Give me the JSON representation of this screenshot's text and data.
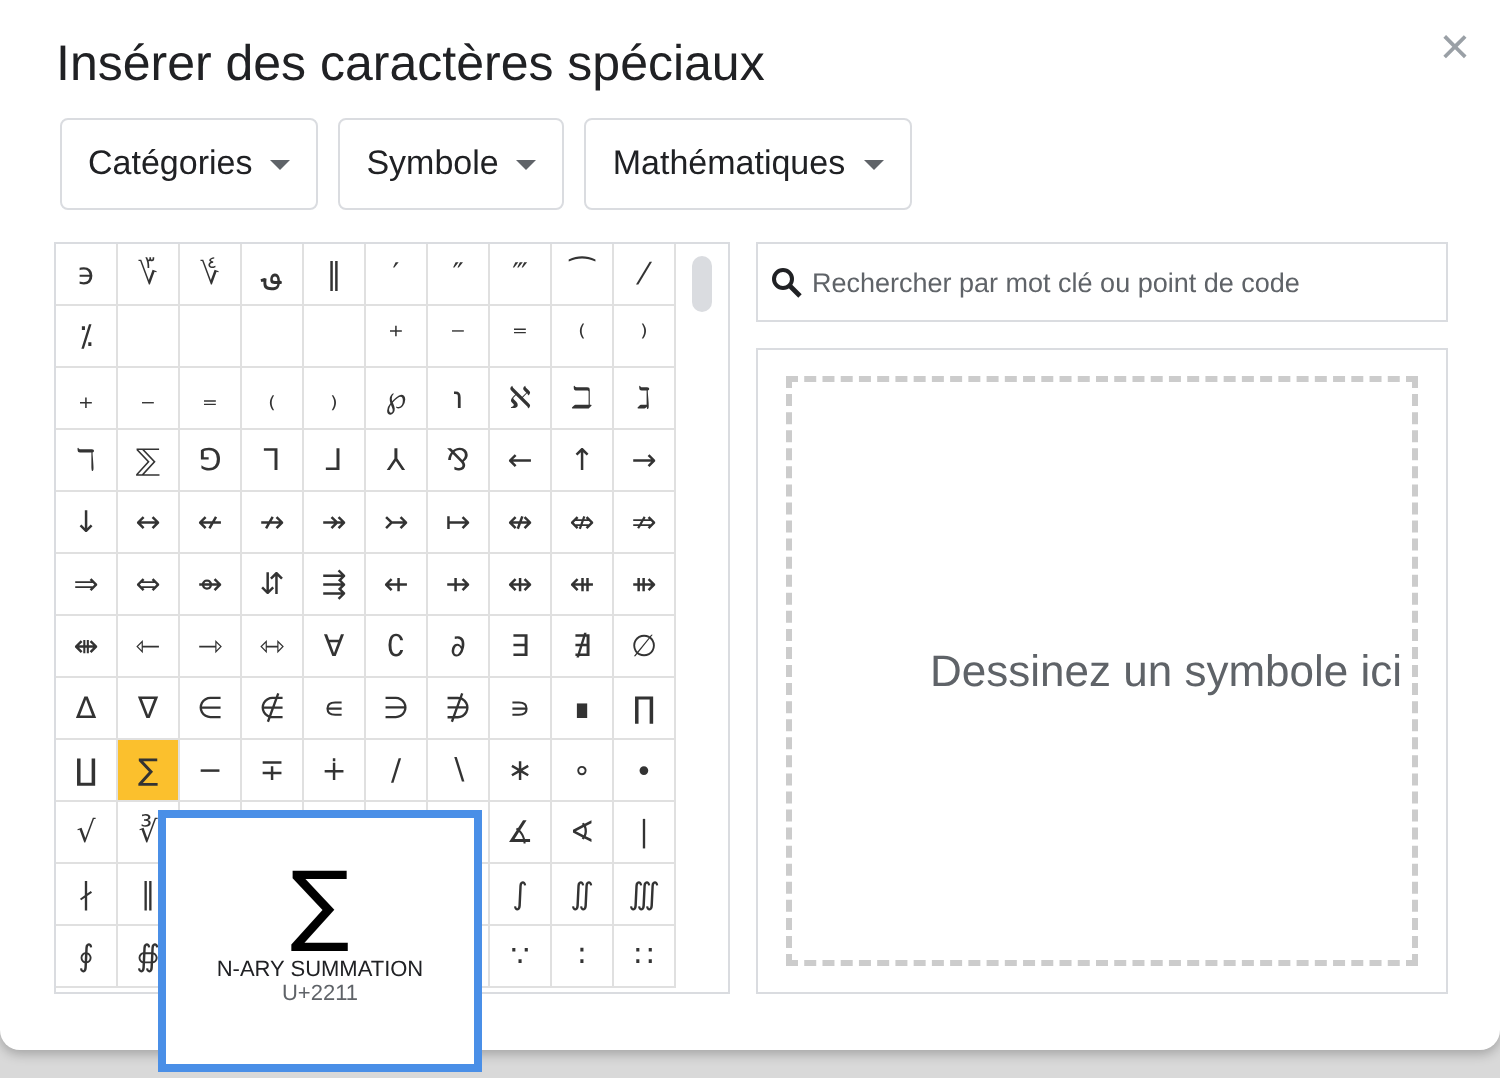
{
  "dialog": {
    "title": "Insérer des caractères spéciaux",
    "close": "×"
  },
  "dropdowns": [
    {
      "label": "Catégories"
    },
    {
      "label": "Symbole"
    },
    {
      "label": "Mathématiques"
    }
  ],
  "grid": {
    "rows": [
      [
        {
          "c": "϶",
          "selected": false
        },
        {
          "c": "؆",
          "selected": false
        },
        {
          "c": "؇",
          "selected": false
        },
        {
          "c": "؈",
          "selected": false
        },
        {
          "c": "‖",
          "selected": false
        },
        {
          "c": "′",
          "selected": false
        },
        {
          "c": "″",
          "selected": false
        },
        {
          "c": "‴",
          "selected": false
        },
        {
          "c": "⁀",
          "selected": false
        },
        {
          "c": "⁄",
          "selected": false
        }
      ],
      [
        {
          "c": "⁒",
          "selected": false
        },
        {
          "kind": "empty"
        },
        {
          "kind": "empty"
        },
        {
          "kind": "empty"
        },
        {
          "kind": "empty"
        },
        {
          "c": "⁺",
          "selected": false
        },
        {
          "c": "⁻",
          "selected": false
        },
        {
          "c": "⁼",
          "selected": false
        },
        {
          "c": "⁽",
          "selected": false
        },
        {
          "c": "⁾",
          "selected": false
        }
      ],
      [
        {
          "c": "₊",
          "selected": false
        },
        {
          "c": "₋",
          "selected": false
        },
        {
          "c": "₌",
          "selected": false
        },
        {
          "c": "₍",
          "selected": false
        },
        {
          "c": "₎",
          "selected": false
        },
        {
          "c": "℘",
          "selected": false
        },
        {
          "c": "℩",
          "selected": false
        },
        {
          "c": "ℵ",
          "selected": false
        },
        {
          "c": "ℶ",
          "selected": false
        },
        {
          "c": "ℷ",
          "selected": false
        }
      ],
      [
        {
          "c": "ℸ",
          "selected": false
        },
        {
          "c": "⅀",
          "selected": false
        },
        {
          "c": "⅁",
          "selected": false
        },
        {
          "c": "⅂",
          "selected": false
        },
        {
          "c": "⅃",
          "selected": false
        },
        {
          "c": "⅄",
          "selected": false
        },
        {
          "c": "⅋",
          "selected": false
        },
        {
          "c": "←",
          "selected": false
        },
        {
          "c": "↑",
          "selected": false
        },
        {
          "c": "→",
          "selected": false
        }
      ],
      [
        {
          "c": "↓",
          "selected": false
        },
        {
          "c": "↔",
          "selected": false
        },
        {
          "c": "↚",
          "selected": false
        },
        {
          "c": "↛",
          "selected": false
        },
        {
          "c": "↠",
          "selected": false
        },
        {
          "c": "↣",
          "selected": false
        },
        {
          "c": "↦",
          "selected": false
        },
        {
          "c": "↮",
          "selected": false
        },
        {
          "c": "⇎",
          "selected": false
        },
        {
          "c": "⇏",
          "selected": false
        }
      ],
      [
        {
          "c": "⇒",
          "selected": false
        },
        {
          "c": "⇔",
          "selected": false
        },
        {
          "c": "⇴",
          "selected": false
        },
        {
          "c": "⇵",
          "selected": false
        },
        {
          "c": "⇶",
          "selected": false
        },
        {
          "c": "⇷",
          "selected": false
        },
        {
          "c": "⇸",
          "selected": false
        },
        {
          "c": "⇹",
          "selected": false
        },
        {
          "c": "⇺",
          "selected": false
        },
        {
          "c": "⇻",
          "selected": false
        }
      ],
      [
        {
          "c": "⇼",
          "selected": false
        },
        {
          "c": "⇽",
          "selected": false
        },
        {
          "c": "⇾",
          "selected": false
        },
        {
          "c": "⇿",
          "selected": false
        },
        {
          "c": "∀",
          "selected": false
        },
        {
          "c": "∁",
          "selected": false
        },
        {
          "c": "∂",
          "selected": false
        },
        {
          "c": "∃",
          "selected": false
        },
        {
          "c": "∄",
          "selected": false
        },
        {
          "c": "∅",
          "selected": false
        }
      ],
      [
        {
          "c": "∆",
          "selected": false
        },
        {
          "c": "∇",
          "selected": false
        },
        {
          "c": "∈",
          "selected": false
        },
        {
          "c": "∉",
          "selected": false
        },
        {
          "c": "∊",
          "selected": false
        },
        {
          "c": "∋",
          "selected": false
        },
        {
          "c": "∌",
          "selected": false
        },
        {
          "c": "∍",
          "selected": false
        },
        {
          "c": "∎",
          "selected": false
        },
        {
          "c": "∏",
          "selected": false
        }
      ],
      [
        {
          "c": "∐",
          "selected": false
        },
        {
          "c": "∑",
          "selected": true
        },
        {
          "c": "−",
          "selected": false
        },
        {
          "c": "∓",
          "selected": false
        },
        {
          "c": "∔",
          "selected": false
        },
        {
          "c": "∕",
          "selected": false
        },
        {
          "c": "∖",
          "selected": false
        },
        {
          "c": "∗",
          "selected": false
        },
        {
          "c": "∘",
          "selected": false
        },
        {
          "c": "∙",
          "selected": false
        }
      ],
      [
        {
          "c": "√",
          "selected": false
        },
        {
          "c": "∛",
          "selected": false
        },
        null,
        null,
        null,
        null,
        null,
        {
          "c": "∡",
          "selected": false
        },
        {
          "c": "∢",
          "selected": false
        },
        {
          "c": "∣",
          "selected": false
        }
      ],
      [
        {
          "c": "∤",
          "selected": false
        },
        {
          "c": "∥",
          "selected": false
        },
        null,
        null,
        null,
        null,
        null,
        {
          "c": "∫",
          "selected": false
        },
        {
          "c": "∬",
          "selected": false
        },
        {
          "c": "∭",
          "selected": false
        }
      ],
      [
        {
          "c": "∮",
          "selected": false
        },
        {
          "c": "∯",
          "selected": false
        },
        null,
        null,
        null,
        null,
        null,
        {
          "c": "∵",
          "selected": false
        },
        {
          "c": "∶",
          "selected": false
        },
        {
          "c": "∷",
          "selected": false
        }
      ]
    ]
  },
  "preview": {
    "glyph": "∑",
    "name": "N-ARY SUMMATION",
    "code": "U+2211"
  },
  "search": {
    "placeholder": "Rechercher par mot clé ou point de code"
  },
  "draw_area": {
    "hint": "Dessinez un symbole ici"
  }
}
